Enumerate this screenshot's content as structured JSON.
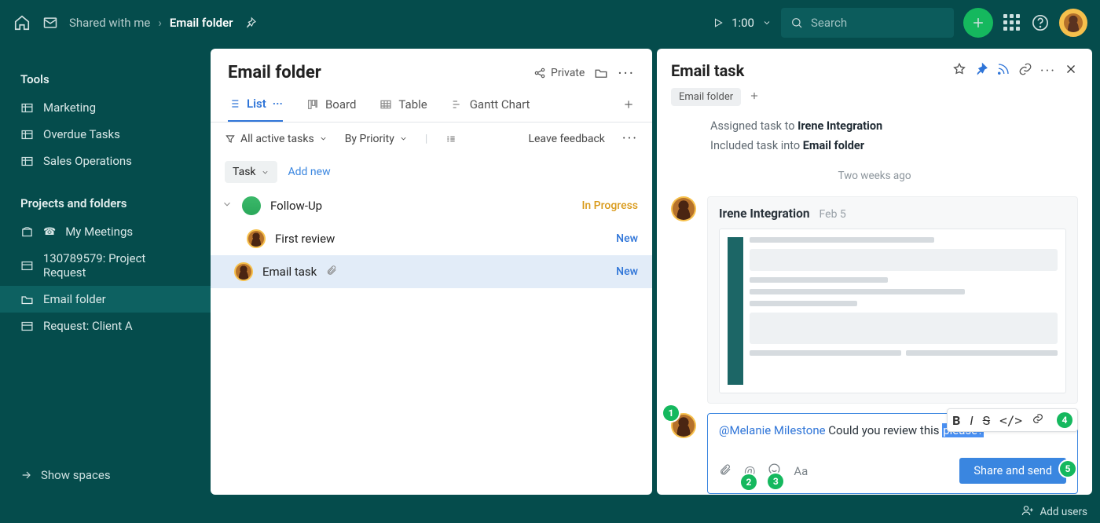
{
  "topbar": {
    "breadcrumb1": "Shared with me",
    "breadcrumb2": "Email folder",
    "timer": "1:00",
    "search_placeholder": "Search"
  },
  "sidebar": {
    "tools_heading": "Tools",
    "tools": [
      {
        "label": "Marketing"
      },
      {
        "label": "Overdue Tasks"
      },
      {
        "label": "Sales Operations"
      }
    ],
    "projects_heading": "Projects and folders",
    "projects": [
      {
        "label": "My Meetings",
        "icon": "contact"
      },
      {
        "label": "130789579: Project Request",
        "icon": "dashboard"
      },
      {
        "label": "Email folder",
        "icon": "folder",
        "active": true
      },
      {
        "label": "Request: Client A",
        "icon": "dashboard"
      }
    ],
    "show_spaces": "Show spaces"
  },
  "center": {
    "title": "Email folder",
    "privacy_label": "Private",
    "views": {
      "list": "List",
      "board": "Board",
      "table": "Table",
      "gantt": "Gantt Chart"
    },
    "filters": {
      "all_active": "All active tasks",
      "by_priority": "By Priority",
      "leave_feedback": "Leave feedback"
    },
    "row_head": {
      "task": "Task",
      "add_new": "Add new"
    },
    "tasks": [
      {
        "title": "Follow-Up",
        "status": "In Progress",
        "status_class": "st-inprog",
        "avatar": "green",
        "parent": true
      },
      {
        "title": "First review",
        "status": "New",
        "status_class": "st-new",
        "avatar": "gold",
        "sub": true
      },
      {
        "title": "Email task",
        "status": "New",
        "status_class": "st-new",
        "avatar": "gold",
        "sub": true,
        "attach": true,
        "selected": true
      }
    ]
  },
  "rpanel": {
    "title": "Email task",
    "folder_tag": "Email folder",
    "activity": {
      "assigned_pre": "Assigned task to ",
      "assigned_to": "Irene Integration",
      "included_pre": "Included task into ",
      "included_in": "Email folder"
    },
    "timestamp": "Two weeks ago",
    "comment_author": "Irene Integration",
    "comment_date": "Feb 5",
    "composer": {
      "mention": "@Melanie Milestone",
      "text_mid": " Could you review this ",
      "text_sel": "please?",
      "send_label": "Share and send",
      "Aa": "Aa"
    },
    "callouts": {
      "c1": "1",
      "c2": "2",
      "c3": "3",
      "c4": "4",
      "c5": "5"
    }
  },
  "footer": {
    "add_users": "Add users"
  }
}
